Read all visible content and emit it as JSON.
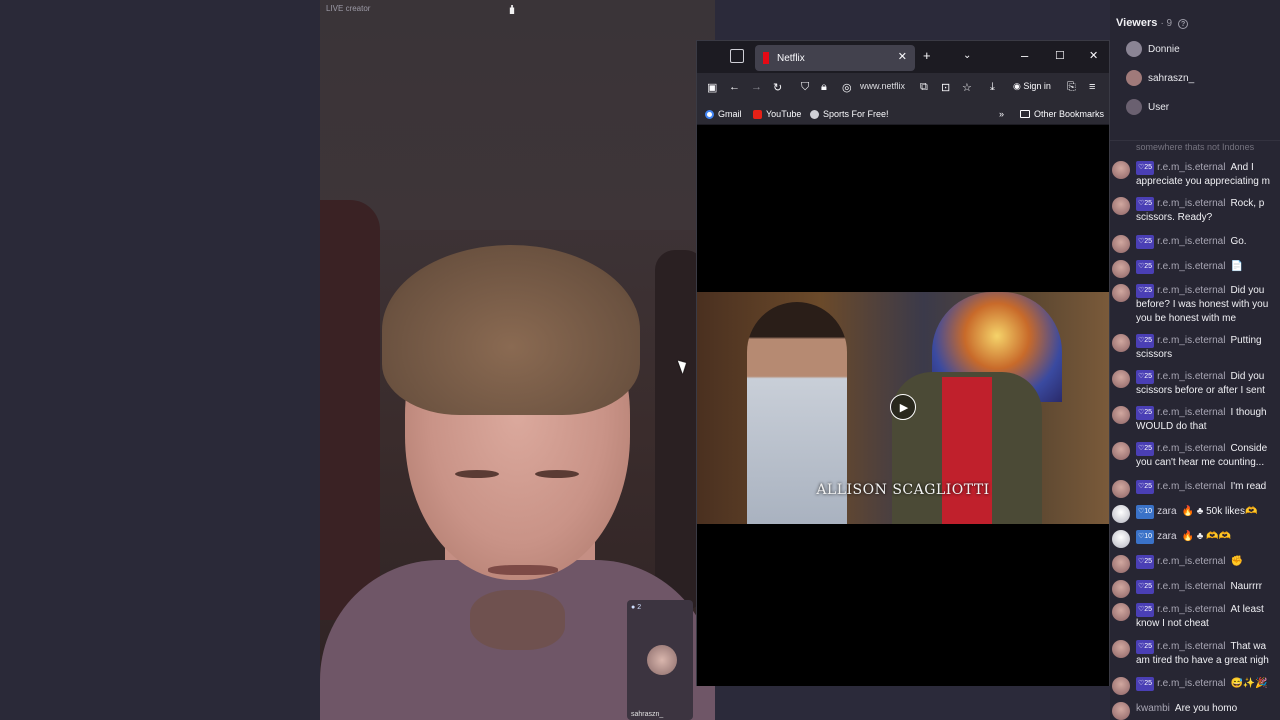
{
  "stream": {
    "live_label": "LIVE creator",
    "guest_count": "2",
    "guest_name": "sahraszn_"
  },
  "browser": {
    "tab_title": "Netflix",
    "url": "www.netflix",
    "sign_in": "Sign in",
    "bookmarks": [
      "Gmail",
      "YouTube",
      "Sports For Free!"
    ],
    "other_bookmarks": "Other Bookmarks",
    "caption": "ALLISON SCAGLIOTTI"
  },
  "viewers": {
    "title": "Viewers",
    "count": "· 9",
    "list": [
      "Donnie",
      "sahraszn_",
      "User"
    ]
  },
  "chat": {
    "cut_text": "somewhere thats not Indones",
    "messages": [
      {
        "badge": "25",
        "user": "r.e.m_is.eternal",
        "l1": "And I",
        "l2": "appreciate you appreciating m"
      },
      {
        "badge": "25",
        "user": "r.e.m_is.eternal",
        "l1": "Rock, p",
        "l2": "scissors. Ready?"
      },
      {
        "badge": "25",
        "user": "r.e.m_is.eternal",
        "l1": "Go.",
        "l2": ""
      },
      {
        "badge": "25",
        "user": "r.e.m_is.eternal",
        "l1": "📄",
        "l2": ""
      },
      {
        "badge": "25",
        "user": "r.e.m_is.eternal",
        "l1": "Did you",
        "l2": "before? I was honest with you",
        "l3": "you be honest with me"
      },
      {
        "badge": "25",
        "user": "r.e.m_is.eternal",
        "l1": "Putting",
        "l2": "scissors"
      },
      {
        "badge": "25",
        "user": "r.e.m_is.eternal",
        "l1": "Did you",
        "l2": "scissors before or after I sent"
      },
      {
        "badge": "25",
        "user": "r.e.m_is.eternal",
        "l1": "I though",
        "l2": "WOULD do that"
      },
      {
        "badge": "25",
        "user": "r.e.m_is.eternal",
        "l1": "Conside",
        "l2": "you can't hear me counting..."
      },
      {
        "badge": "25",
        "user": "r.e.m_is.eternal",
        "l1": "I'm read",
        "l2": ""
      },
      {
        "badge": "10",
        "user": "zara",
        "l1": "🔥 ♣ 50k likes🫶",
        "l2": ""
      },
      {
        "badge": "10",
        "user": "zara",
        "l1": "🔥 ♣ 🫶🫶",
        "l2": ""
      },
      {
        "badge": "25",
        "user": "r.e.m_is.eternal",
        "l1": "✊",
        "l2": ""
      },
      {
        "badge": "25",
        "user": "r.e.m_is.eternal",
        "l1": "Naurrrr",
        "l2": ""
      },
      {
        "badge": "25",
        "user": "r.e.m_is.eternal",
        "l1": "At least",
        "l2": "know I not cheat"
      },
      {
        "badge": "25",
        "user": "r.e.m_is.eternal",
        "l1": "That wa",
        "l2": "am tired tho have a great nigh"
      },
      {
        "badge": "25",
        "user": "r.e.m_is.eternal",
        "l1": "😅✨🎉",
        "l2": ""
      },
      {
        "badge": "",
        "user": "kwambi",
        "l1": "Are you homo",
        "l2": ""
      }
    ]
  }
}
